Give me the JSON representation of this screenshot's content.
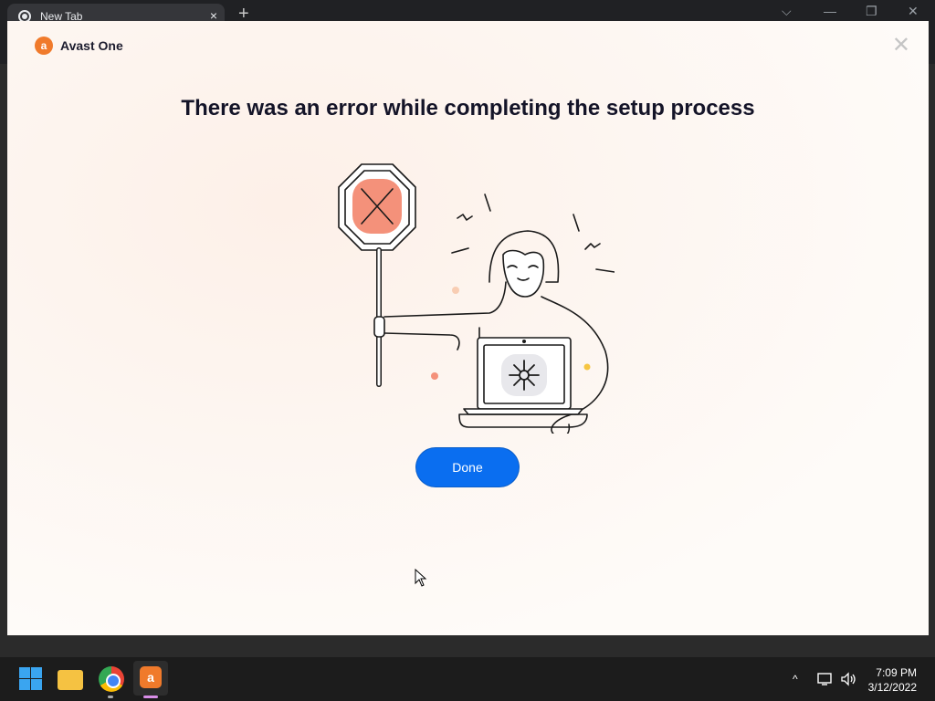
{
  "browser": {
    "tab_title": "New Tab",
    "tab_close": "×",
    "new_tab": "+",
    "controls": {
      "chevron": "⌵",
      "minimize": "—",
      "restore": "❐",
      "close": "✕"
    }
  },
  "installer": {
    "brand_name": "Avast One",
    "close_symbol": "✕",
    "headline": "There was an error while completing the setup process",
    "done_label": "Done",
    "colors": {
      "accent": "#0a6ef0",
      "brand": "#f07a2b",
      "stop_sign": "#f4917a"
    }
  },
  "taskbar": {
    "apps": [
      "windows-start",
      "file-explorer",
      "google-chrome",
      "avast-one"
    ],
    "tray": {
      "chevron": "^",
      "network_icon": "network-icon",
      "volume_icon": "volume-icon"
    },
    "time": "7:09 PM",
    "date": "3/12/2022"
  }
}
